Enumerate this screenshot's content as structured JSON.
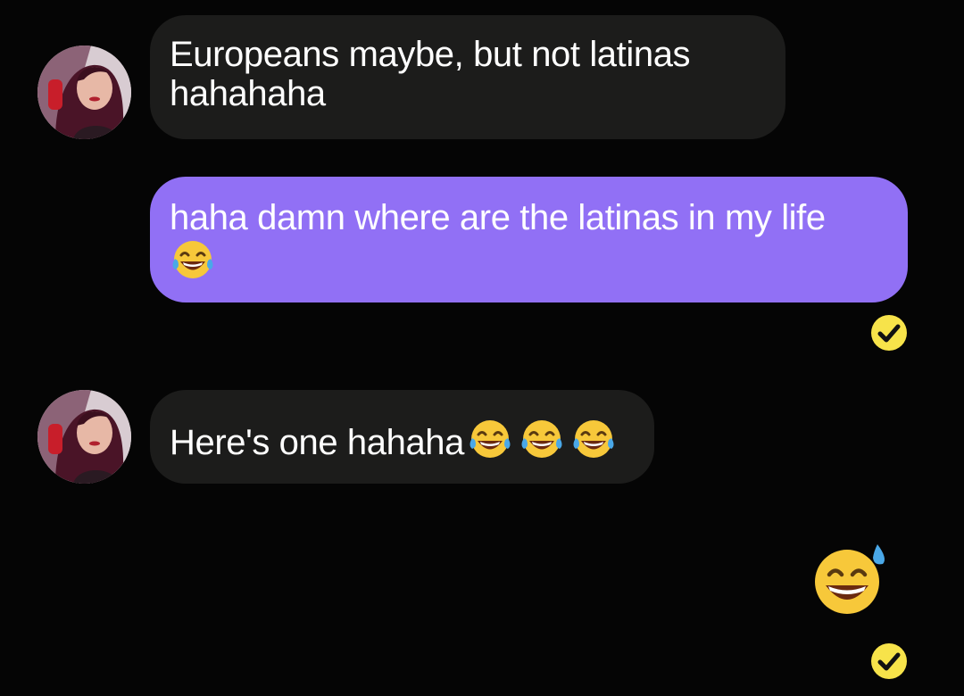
{
  "messages": [
    {
      "direction": "incoming",
      "text_line1": "Europeans maybe, but not latinas",
      "text_line2": "hahahaha"
    },
    {
      "direction": "outgoing",
      "text": "haha damn where are the latinas in my life",
      "emoji": "face-with-tears-of-joy",
      "status": "read-check-icon"
    },
    {
      "direction": "incoming",
      "text": "Here's one hahaha",
      "emoji_count": 3,
      "emoji": "face-with-tears-of-joy"
    },
    {
      "direction": "outgoing",
      "emoji": "grinning-face-with-sweat",
      "status": "read-check-icon"
    }
  ],
  "colors": {
    "background": "#050505",
    "incoming_bubble": "#1c1c1b",
    "outgoing_bubble": "#9170f5",
    "check_badge": "#f7e34a"
  }
}
